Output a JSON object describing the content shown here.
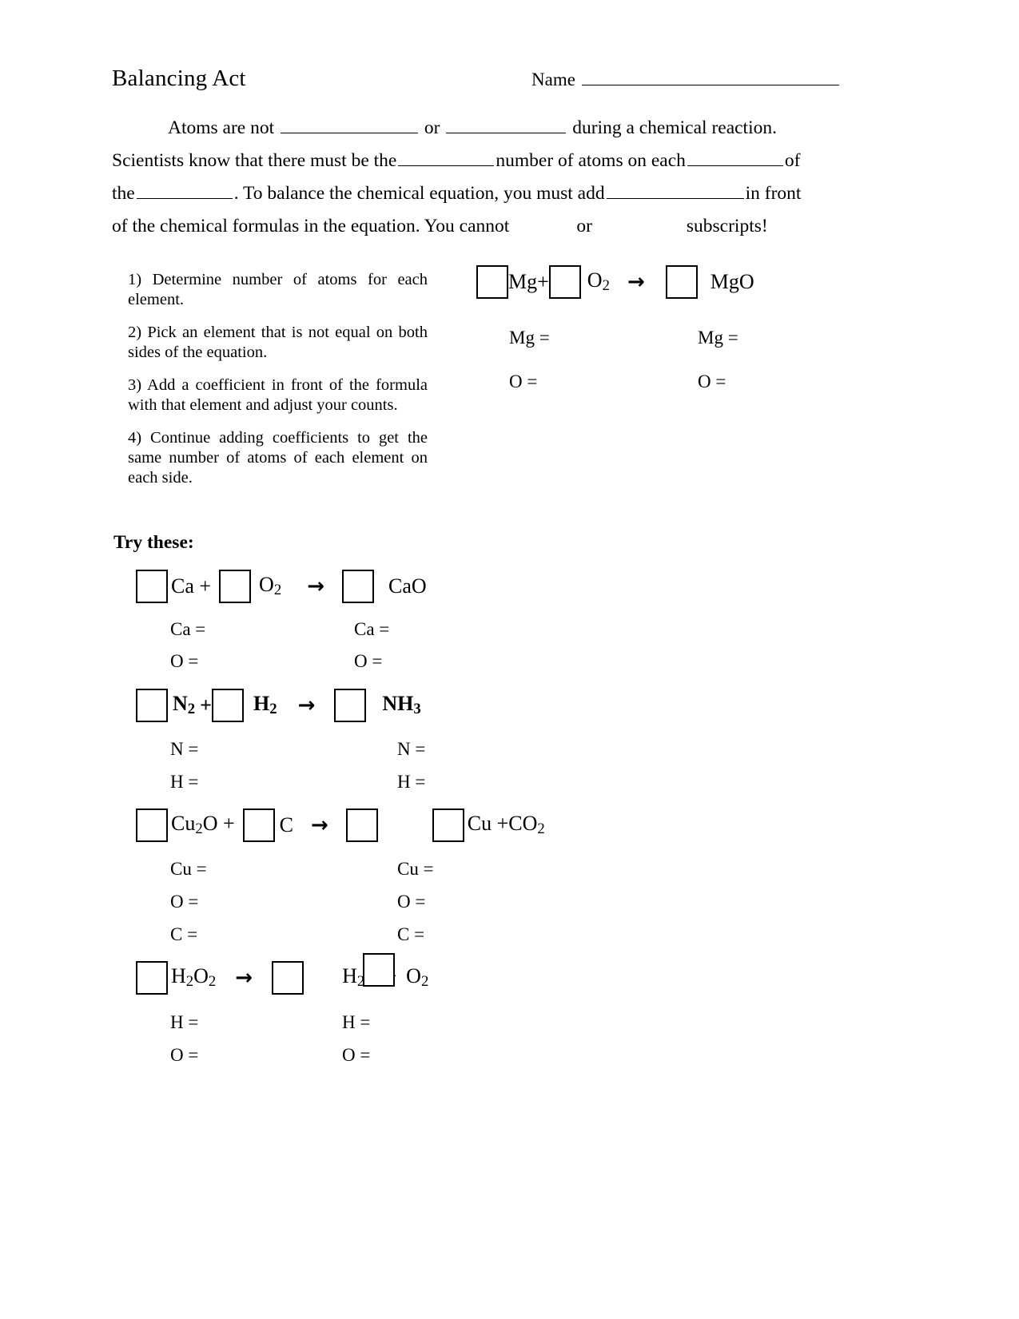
{
  "document": {
    "title": "Balancing Act",
    "name_label": "Name"
  },
  "intro": {
    "line1_a": "Atoms   are  not",
    "line1_or": "or",
    "line1_b": "during a chemical reaction.",
    "line2_a": "Scientists know that there must  be the",
    "line2_b": "number of atoms  on each",
    "line2_c": "of",
    "line3_a": "the",
    "line3_b": ". To balance the chemical equation,  you must add",
    "line3_c": "in  front",
    "line4_a": "of the chemical formulas in the equation.  You cannot",
    "line4_b": "or",
    "line4_c": "subscripts!"
  },
  "steps": [
    "1)  Determine number of atoms for each element.",
    "2) Pick an element that is not equal on both sides of the equation.",
    "3) Add a coefficient in front of the formula with that element and adjust your counts.",
    "4) Continue adding coefficients to get the same number of atoms of each element on each side."
  ],
  "example": {
    "equation": {
      "reactant1": "Mg",
      "plus": "+",
      "reactant2_base": "O",
      "reactant2_sub": "2",
      "arrow": "→",
      "product": "MgO"
    },
    "counts_left": [
      "Mg =",
      "O ="
    ],
    "counts_right": [
      "Mg =",
      "O ="
    ]
  },
  "try_these": {
    "heading": "Try these:",
    "problems": [
      {
        "id": "ca",
        "equation": {
          "reactant1": "Ca +",
          "reactant2_base": "O",
          "reactant2_sub": "2",
          "arrow": "→",
          "product": "CaO"
        },
        "counts_left": [
          "Ca =",
          "O ="
        ],
        "counts_right": [
          "Ca =",
          "O ="
        ]
      },
      {
        "id": "n2",
        "equation": {
          "reactant1_base": "N",
          "reactant1_sub": "2",
          "plus": "+",
          "reactant2_base": "H",
          "reactant2_sub": "2",
          "arrow": "→",
          "product_base": "NH",
          "product_sub": "3"
        },
        "counts_left": [
          "N =",
          "H ="
        ],
        "counts_right": [
          "N =",
          "H ="
        ]
      },
      {
        "id": "cu2o",
        "equation": {
          "reactant1_pre": "Cu",
          "reactant1_sub": "2",
          "reactant1_post": "O  +",
          "reactant2": "C",
          "arrow": "→",
          "product_pre": "Cu +CO",
          "product_sub": "2"
        },
        "counts_left": [
          "Cu =",
          "O =",
          "C ="
        ],
        "counts_right": [
          "Cu =",
          "O =",
          "C ="
        ]
      },
      {
        "id": "h2o2",
        "equation": {
          "reactant1_a": "H",
          "reactant1_sub1": "2",
          "reactant1_b": "O",
          "reactant1_sub2": "2",
          "arrow": "→",
          "product_a": "H",
          "product_sub1": "2",
          "product_b": "O +",
          "product_c": "O",
          "product_sub2": "2"
        },
        "counts_left": [
          "H =",
          "O ="
        ],
        "counts_right": [
          "H =",
          "O ="
        ]
      }
    ]
  }
}
